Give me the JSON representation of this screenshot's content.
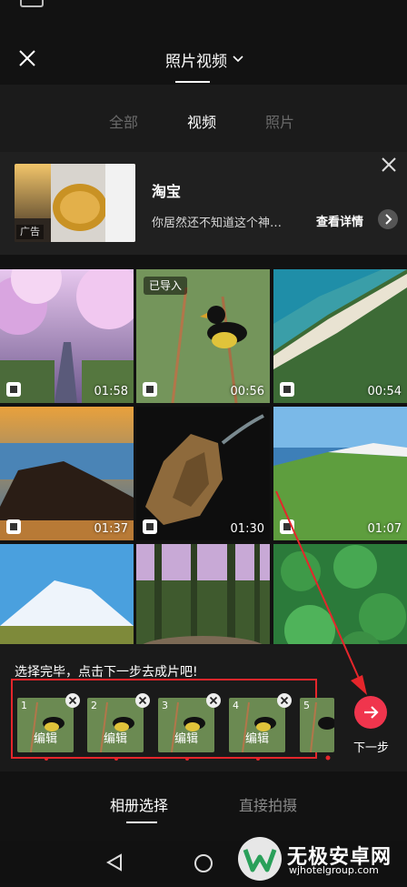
{
  "header": {
    "title": "照片视频"
  },
  "filter_tabs": [
    {
      "label": "全部",
      "active": false
    },
    {
      "label": "视频",
      "active": true
    },
    {
      "label": "照片",
      "active": false
    }
  ],
  "ad": {
    "badge": "广告",
    "title": "淘宝",
    "description": "你居然还不知道这个神…",
    "cta": "查看详情"
  },
  "grid": [
    {
      "scene": "cherry-blossom-road",
      "duration": "01:58",
      "imported": false
    },
    {
      "scene": "bird-on-reeds",
      "duration": "00:56",
      "imported": true,
      "imported_label": "已导入"
    },
    {
      "scene": "turquoise-coast",
      "duration": "00:54",
      "imported": false
    },
    {
      "scene": "sunset-beach-rocks",
      "duration": "01:37",
      "imported": false
    },
    {
      "scene": "dark-rock-water",
      "duration": "01:30",
      "imported": false
    },
    {
      "scene": "green-coastline",
      "duration": "01:07",
      "imported": false
    },
    {
      "scene": "snow-mountain",
      "duration": "",
      "imported": false
    },
    {
      "scene": "forest-lake",
      "duration": "",
      "imported": false
    },
    {
      "scene": "forest-aerial",
      "duration": "",
      "imported": false
    }
  ],
  "selection": {
    "hint": "选择完毕，点击下一步去成片吧!",
    "items": [
      {
        "index": "1",
        "edit_label": "编辑"
      },
      {
        "index": "2",
        "edit_label": "编辑"
      },
      {
        "index": "3",
        "edit_label": "编辑"
      },
      {
        "index": "4",
        "edit_label": "编辑"
      },
      {
        "index": "5",
        "edit_label": ""
      }
    ],
    "next_label": "下一步"
  },
  "bottom_tabs": [
    {
      "label": "相册选择",
      "active": true
    },
    {
      "label": "直接拍摄",
      "active": false
    }
  ],
  "watermark": {
    "name": "无极安卓网",
    "url": "wjhotelgroup.com"
  },
  "colors": {
    "accent": "#f0354d",
    "highlight": "#e5262b",
    "background": "#121212"
  }
}
